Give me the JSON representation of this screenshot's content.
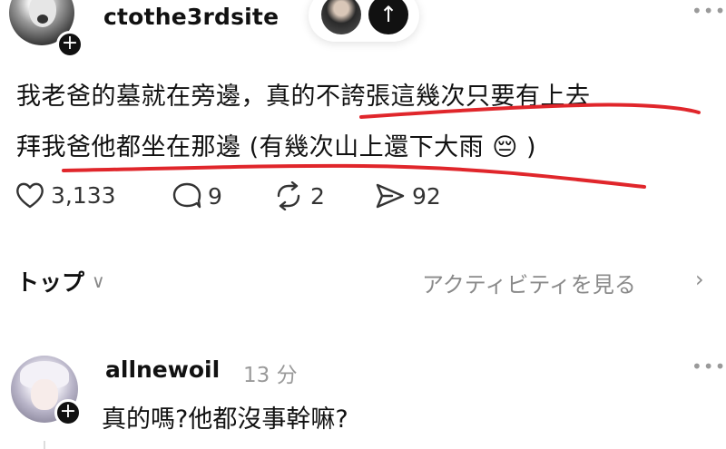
{
  "post": {
    "username": "ctothe3rdsite",
    "avatar_icon": "person-avatar",
    "follow_badge": "+",
    "text_line1": "我老爸的墓就在旁邊，真的不誇張這幾次只要有上去",
    "text_line2": "拜我爸他都坐在那邊 (有幾次山上還下大雨",
    "text_line2_emoji": "😔",
    "text_line2_end": ")",
    "stats": {
      "likes": "3,133",
      "comments": "9",
      "reposts": "2",
      "shares": "92"
    },
    "annotation_color": "#e0262b"
  },
  "floating_pill": {
    "arrow": "↑"
  },
  "tabs": {
    "top_label": "トップ",
    "top_chevron": "∨",
    "activity_label": "アクティビティを見る",
    "activity_chevron": "›"
  },
  "more_icon": "•••",
  "reply": {
    "username": "allnewoil",
    "time": "13 分",
    "follow_badge": "+",
    "text": "真的嗎?他都沒事幹嘛?"
  }
}
